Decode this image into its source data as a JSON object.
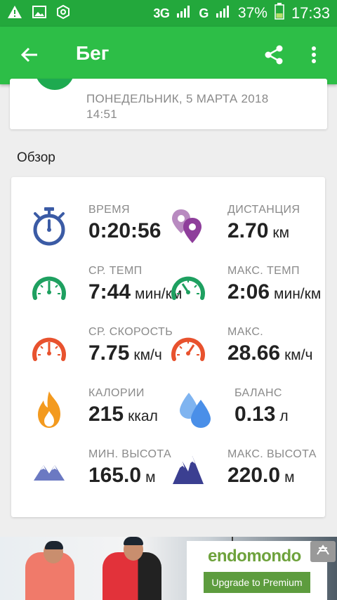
{
  "status_bar": {
    "network_1": "3G",
    "network_2": "G",
    "battery": "37%",
    "time": "17:33",
    "icons": [
      "warning-icon",
      "image-icon",
      "settings-icon",
      "signal-icon",
      "battery-icon"
    ]
  },
  "toolbar": {
    "title": "Бег",
    "back_icon": "arrow-back-icon",
    "share_icon": "share-icon",
    "menu_icon": "more-vert-icon"
  },
  "workout": {
    "date": "ПОНЕДЕЛЬНИК, 5 МАРТА 2018",
    "time": "14:51"
  },
  "overview": {
    "title": "Обзор",
    "stats": [
      {
        "label": "ВРЕМЯ",
        "value": "0:20:56",
        "unit": "",
        "icon": "stopwatch-icon",
        "color": "#3b5ba5"
      },
      {
        "label": "ДИСТАНЦИЯ",
        "value": "2.70",
        "unit": "км",
        "icon": "map-pins-icon",
        "color": "#8e3e9b"
      },
      {
        "label": "СР. ТЕМП",
        "value": "7:44",
        "unit": "мин/км",
        "icon": "pace-gauge-icon",
        "color": "#1ea060"
      },
      {
        "label": "МАКС. ТЕМП",
        "value": "2:06",
        "unit": "мин/км",
        "icon": "max-pace-gauge-icon",
        "color": "#1ea060"
      },
      {
        "label": "СР. СКОРОСТЬ",
        "value": "7.75",
        "unit": "км/ч",
        "icon": "speed-gauge-icon",
        "color": "#e8522e"
      },
      {
        "label": "МАКС.",
        "value": "28.66",
        "unit": "км/ч",
        "icon": "max-speed-gauge-icon",
        "color": "#e8522e"
      },
      {
        "label": "КАЛОРИИ",
        "value": "215",
        "unit": "ккал",
        "icon": "flame-icon",
        "color": "#f39a1f"
      },
      {
        "label": "БАЛАНС",
        "value": "0.13",
        "unit": "л",
        "icon": "water-drops-icon",
        "color": "#4a8fe8"
      },
      {
        "label": "МИН. ВЫСОТА",
        "value": "165.0",
        "unit": "м",
        "icon": "min-altitude-icon",
        "color": "#6b79c2"
      },
      {
        "label": "МАКС. ВЫСОТА",
        "value": "220.0",
        "unit": "м",
        "icon": "max-altitude-icon",
        "color": "#3b3f91"
      }
    ]
  },
  "ad": {
    "brand": "endomondo",
    "cta": "Upgrade to Premium",
    "close_icon": "ad-close-icon"
  },
  "colors": {
    "status_bar": "#23a83c",
    "toolbar": "#2dbe47",
    "accent_green": "#5d9c3e"
  }
}
